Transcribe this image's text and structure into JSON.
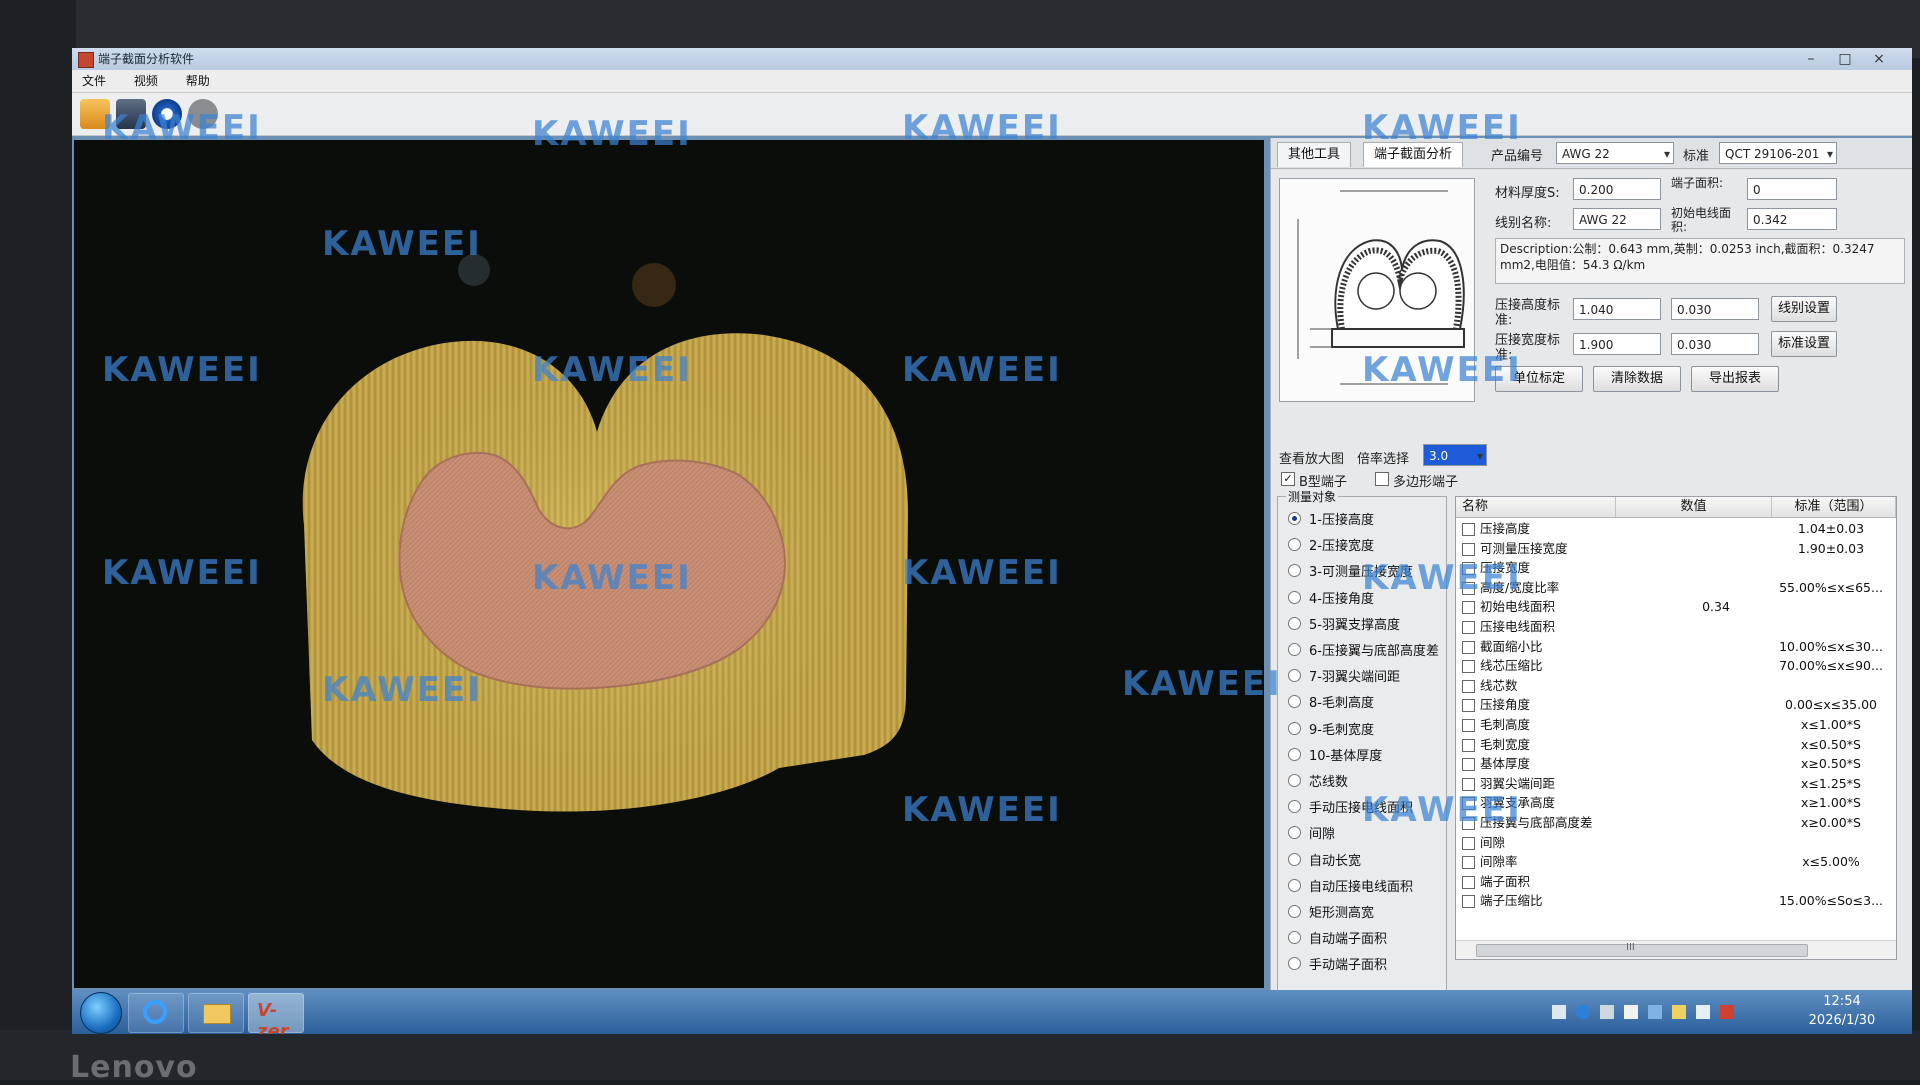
{
  "app": {
    "title": "端子截面分析软件",
    "menu": [
      "文件",
      "视频",
      "帮助"
    ]
  },
  "right_panel": {
    "tabs": [
      "其他工具",
      "端子截面分析"
    ],
    "product_label": "产品编号",
    "product_value": "AWG 22",
    "standard_label": "标准",
    "standard_value": "QCT 29106-201",
    "thickness_label": "材料厚度S:",
    "thickness_value": "0.200",
    "terminal_area_label": "端子面积:",
    "terminal_area_value": "0",
    "wire_name_label": "线别名称:",
    "wire_name_value": "AWG 22",
    "init_wire_area_label": "初始电线面积:",
    "init_wire_area_value": "0.342",
    "description": "Description:公制：0.643 mm,英制：0.0253 inch,截面积：0.3247 mm2,电阻值：54.3 Ω/km",
    "crimp_height_label": "压接高度标准:",
    "crimp_height_value": "1.040",
    "crimp_height_tol": "0.030",
    "crimp_width_label": "压接宽度标准:",
    "crimp_width_value": "1.900",
    "crimp_width_tol": "0.030",
    "wire_setting_button": "线别设置",
    "standard_setting_button": "标准设置",
    "unit_calibration_button": "单位标定",
    "clear_data_button": "清除数据",
    "export_report_button": "导出报表",
    "zoom_view_label": "查看放大图",
    "magnification_label": "倍率选择",
    "magnification_value": "3.0",
    "b_terminal_label": "B型端子",
    "b_terminal_checked": true,
    "polygon_terminal_label": "多边形端子",
    "polygon_terminal_checked": false,
    "measure_group_title": "测量对象",
    "measure_items": [
      "1-压接高度",
      "2-压接宽度",
      "3-可测量压接宽度",
      "4-压接角度",
      "5-羽翼支撑高度",
      "6-压接翼与底部高度差",
      "7-羽翼尖端间距",
      "8-毛刺高度",
      "9-毛刺宽度",
      "10-基体厚度",
      "芯线数",
      "手动压接电线面积",
      "间隙",
      "自动长宽",
      "自动压接电线面积",
      "矩形测高宽",
      "自动端子面积",
      "手动端子面积"
    ],
    "selected_measure_index": 0,
    "table_headers": [
      "名称",
      "数值",
      "标准（范围）"
    ],
    "table_rows": [
      {
        "name": "压接高度",
        "value": "",
        "standard": "1.04±0.03"
      },
      {
        "name": "可测量压接宽度",
        "value": "",
        "standard": "1.90±0.03"
      },
      {
        "name": "压接宽度",
        "value": "",
        "standard": ""
      },
      {
        "name": "高度/宽度比率",
        "value": "",
        "standard": "55.00%≤x≤65..."
      },
      {
        "name": "初始电线面积",
        "value": "0.34",
        "standard": ""
      },
      {
        "name": "压接电线面积",
        "value": "",
        "standard": ""
      },
      {
        "name": "截面缩小比",
        "value": "",
        "standard": "10.00%≤x≤30..."
      },
      {
        "name": "线芯压缩比",
        "value": "",
        "standard": "70.00%≤x≤90..."
      },
      {
        "name": "线芯数",
        "value": "",
        "standard": ""
      },
      {
        "name": "压接角度",
        "value": "",
        "standard": "0.00≤x≤35.00"
      },
      {
        "name": "毛刺高度",
        "value": "",
        "standard": "x≤1.00*S"
      },
      {
        "name": "毛刺宽度",
        "value": "",
        "standard": "x≤0.50*S"
      },
      {
        "name": "基体厚度",
        "value": "",
        "standard": "x≥0.50*S"
      },
      {
        "name": "羽翼尖端间距",
        "value": "",
        "standard": "x≤1.25*S"
      },
      {
        "name": "羽翼支承高度",
        "value": "",
        "standard": "x≥1.00*S"
      },
      {
        "name": "压接翼与底部高度差",
        "value": "",
        "standard": "x≥0.00*S"
      },
      {
        "name": "间隙",
        "value": "",
        "standard": ""
      },
      {
        "name": "间隙率",
        "value": "",
        "standard": "x≤5.00%"
      },
      {
        "name": "端子面积",
        "value": "",
        "standard": ""
      },
      {
        "name": "端子压缩比",
        "value": "",
        "standard": "15.00%≤So≤3..."
      }
    ],
    "scroll_marker": "III"
  },
  "taskbar": {
    "app_label": "V-zer",
    "time": "12:54",
    "date": "2026/1/30"
  },
  "watermark_text": "KAWEEI",
  "bezel_brand": "Lenovo",
  "colors": {
    "terminal_gold": "#c8a84a",
    "copper_core": "#c88f74",
    "background": "#0b0d0a",
    "taskbar": "#2c5f9b",
    "watermark": "#3c82d2"
  }
}
